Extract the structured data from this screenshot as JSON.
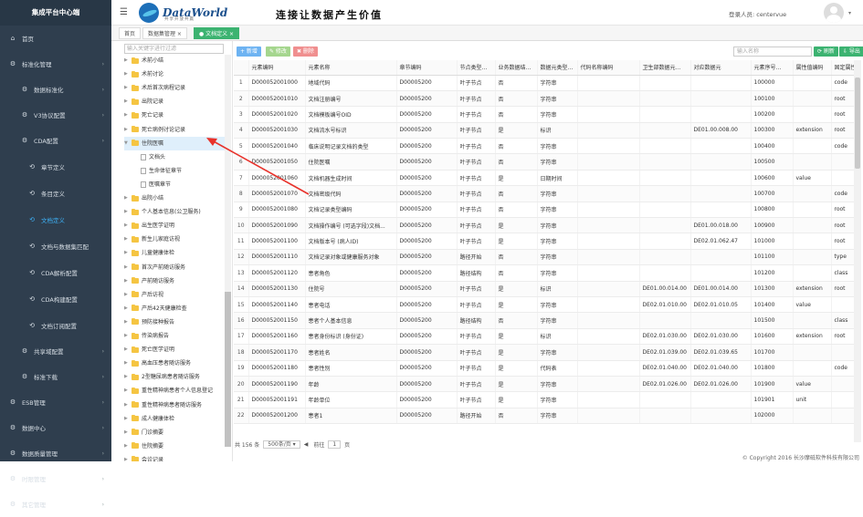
{
  "sidebar": {
    "brand": "集成平台中心端",
    "items": [
      {
        "label": "首页",
        "icon": "home-icon",
        "level": 0,
        "expand": false
      },
      {
        "label": "标准化管理",
        "icon": "gear-icon",
        "level": 0,
        "expand": true
      },
      {
        "label": "数据标准化",
        "icon": "gear-icon",
        "level": 1,
        "expand": true
      },
      {
        "label": "V3协议配置",
        "icon": "gear-icon",
        "level": 1,
        "expand": true
      },
      {
        "label": "CDA配置",
        "icon": "gear-icon",
        "level": 1,
        "expand": true
      },
      {
        "label": "章节定义",
        "icon": "share-icon",
        "level": 2,
        "active": false
      },
      {
        "label": "条目定义",
        "icon": "share-icon",
        "level": 2,
        "active": false
      },
      {
        "label": "文档定义",
        "icon": "share-icon",
        "level": 2,
        "active": true
      },
      {
        "label": "文档与数据集匹配",
        "icon": "share-icon",
        "level": 2,
        "active": false
      },
      {
        "label": "CDA解析配置",
        "icon": "share-icon",
        "level": 2,
        "active": false
      },
      {
        "label": "CDA构建配置",
        "icon": "share-icon",
        "level": 2,
        "active": false
      },
      {
        "label": "文档订阅配置",
        "icon": "share-icon",
        "level": 2,
        "active": false
      },
      {
        "label": "共享域配置",
        "icon": "gear-icon",
        "level": 1,
        "expand": true
      },
      {
        "label": "标准下载",
        "icon": "gear-icon",
        "level": 1,
        "expand": true
      },
      {
        "label": "ESB管理",
        "icon": "gear-icon",
        "level": 0,
        "expand": true
      },
      {
        "label": "数据中心",
        "icon": "gear-icon",
        "level": 0,
        "expand": true
      },
      {
        "label": "数据质量管理",
        "icon": "gear-icon",
        "level": 0,
        "expand": true
      },
      {
        "label": "时限管理",
        "icon": "gear-icon",
        "level": 0,
        "expand": true
      },
      {
        "label": "其它管理",
        "icon": "gear-icon",
        "level": 0,
        "expand": true
      }
    ]
  },
  "header": {
    "logo_text": "DataWorld",
    "logo_sub": "共享开放共赢",
    "slogan": "连接让数据产生价值",
    "login_label": "登录人员: centervue"
  },
  "tabs": [
    {
      "label": "首页",
      "active": false
    },
    {
      "label": "数据集管理 ×",
      "active": false
    },
    {
      "label": "● 文档定义 ×",
      "active": true
    }
  ],
  "tree": {
    "search_placeholder": "输入关键字进行过滤",
    "nodes": [
      {
        "label": "术前小结",
        "type": "folder",
        "level": 0
      },
      {
        "label": "术前讨论",
        "type": "folder",
        "level": 0
      },
      {
        "label": "术后首次病程记录",
        "type": "folder",
        "level": 0
      },
      {
        "label": "出院记录",
        "type": "folder",
        "level": 0
      },
      {
        "label": "死亡记录",
        "type": "folder",
        "level": 0
      },
      {
        "label": "死亡病例讨论记录",
        "type": "folder",
        "level": 0
      },
      {
        "label": "住院医嘱",
        "type": "folder",
        "level": 0,
        "open": true,
        "selected": true
      },
      {
        "label": "文档头",
        "type": "file",
        "level": 1
      },
      {
        "label": "生命体征章节",
        "type": "file",
        "level": 1
      },
      {
        "label": "医嘱章节",
        "type": "file",
        "level": 1
      },
      {
        "label": "出院小结",
        "type": "folder",
        "level": 0
      },
      {
        "label": "个人基本信息(公卫服务)",
        "type": "folder",
        "level": 0
      },
      {
        "label": "出生医学证明",
        "type": "folder",
        "level": 0
      },
      {
        "label": "新生儿家庭访视",
        "type": "folder",
        "level": 0
      },
      {
        "label": "儿童健康体检",
        "type": "folder",
        "level": 0
      },
      {
        "label": "首次产前随访服务",
        "type": "folder",
        "level": 0
      },
      {
        "label": "产前随访服务",
        "type": "folder",
        "level": 0
      },
      {
        "label": "产后访视",
        "type": "folder",
        "level": 0
      },
      {
        "label": "产后42天健康检查",
        "type": "folder",
        "level": 0
      },
      {
        "label": "预防接种报告",
        "type": "folder",
        "level": 0
      },
      {
        "label": "传染病报告",
        "type": "folder",
        "level": 0
      },
      {
        "label": "死亡医学证明",
        "type": "folder",
        "level": 0
      },
      {
        "label": "高血压患者随访服务",
        "type": "folder",
        "level": 0
      },
      {
        "label": "2型糖尿病患者随访服务",
        "type": "folder",
        "level": 0
      },
      {
        "label": "重性精神病患者个人信息登记",
        "type": "folder",
        "level": 0
      },
      {
        "label": "重性精神病患者随访服务",
        "type": "folder",
        "level": 0
      },
      {
        "label": "成人健康体检",
        "type": "folder",
        "level": 0
      },
      {
        "label": "门诊摘要",
        "type": "folder",
        "level": 0
      },
      {
        "label": "住院摘要",
        "type": "folder",
        "level": 0
      },
      {
        "label": "会诊记录",
        "type": "folder",
        "level": 0
      }
    ]
  },
  "toolbar": {
    "add_label": "+ 新增",
    "edit_label": "✎ 修改",
    "delete_label": "✖ 删除",
    "search_placeholder": "输入名称",
    "refresh_label": "⟳ 刷新",
    "export_label": "⇩ 导出"
  },
  "table": {
    "columns": [
      "",
      "元素编码",
      "元素名称",
      "章节编码",
      "节点类型...",
      "业务数据结...",
      "数据元类型...",
      "代码名称编码",
      "卫生部数据元...",
      "对应数据元",
      "元素序号...",
      "属性值编码",
      "固定属性"
    ],
    "rows": [
      [
        "1",
        "D000052001000",
        "地域代码",
        "D00005200",
        "叶子节点",
        "否",
        "字符串",
        "",
        "",
        "",
        "100000",
        "",
        "code"
      ],
      [
        "2",
        "D000052001010",
        "文档注册编号",
        "D00005200",
        "叶子节点",
        "否",
        "字符串",
        "",
        "",
        "",
        "100100",
        "",
        "root"
      ],
      [
        "3",
        "D000052001020",
        "文档模板编号OID",
        "D00005200",
        "叶子节点",
        "否",
        "字符串",
        "",
        "",
        "",
        "100200",
        "",
        "root"
      ],
      [
        "4",
        "D000052001030",
        "文档流水号标识",
        "D00005200",
        "叶子节点",
        "是",
        "标识",
        "",
        "",
        "DE01.00.008.00",
        "100300",
        "extension",
        "root"
      ],
      [
        "5",
        "D000052001040",
        "临床说明记录文档的类型",
        "D00005200",
        "叶子节点",
        "否",
        "字符串",
        "",
        "",
        "",
        "100400",
        "",
        "code"
      ],
      [
        "6",
        "D000052001050",
        "住院医嘱",
        "D00005200",
        "叶子节点",
        "否",
        "字符串",
        "",
        "",
        "",
        "100500",
        "",
        ""
      ],
      [
        "7",
        "D000052001060",
        "文档机器生成时间",
        "D00005200",
        "叶子节点",
        "是",
        "日期时间",
        "",
        "",
        "",
        "100600",
        "value",
        ""
      ],
      [
        "8",
        "D000052001070",
        "文档密级代码",
        "D00005200",
        "叶子节点",
        "否",
        "字符串",
        "",
        "",
        "",
        "100700",
        "",
        "code"
      ],
      [
        "9",
        "D000052001080",
        "文档记录类型编码",
        "D00005200",
        "叶子节点",
        "否",
        "字符串",
        "",
        "",
        "",
        "100800",
        "",
        "root"
      ],
      [
        "10",
        "D000052001090",
        "文档操作编号 (可选字段)文档...",
        "D00005200",
        "叶子节点",
        "是",
        "字符串",
        "",
        "",
        "DE01.00.018.00",
        "100900",
        "",
        "root"
      ],
      [
        "11",
        "D000052001100",
        "文档版本号 (病人ID)",
        "D00005200",
        "叶子节点",
        "是",
        "字符串",
        "",
        "",
        "DE02.01.062.47",
        "101000",
        "",
        "root"
      ],
      [
        "12",
        "D000052001110",
        "文档记录对象或健康服务对象",
        "D00005200",
        "路径开始",
        "否",
        "字符串",
        "",
        "",
        "",
        "101100",
        "",
        "type"
      ],
      [
        "13",
        "D000052001120",
        "患者角色",
        "D00005200",
        "路径结构",
        "否",
        "字符串",
        "",
        "",
        "",
        "101200",
        "",
        "class"
      ],
      [
        "14",
        "D000052001130",
        "住院号",
        "D00005200",
        "叶子节点",
        "是",
        "标识",
        "",
        "DE01.00.014.00",
        "DE01.00.014.00",
        "101300",
        "extension",
        "root"
      ],
      [
        "15",
        "D000052001140",
        "患者电话",
        "D00005200",
        "叶子节点",
        "是",
        "字符串",
        "",
        "DE02.01.010.00",
        "DE02.01.010.05",
        "101400",
        "value",
        ""
      ],
      [
        "16",
        "D000052001150",
        "患者个人基本信息",
        "D00005200",
        "路径结构",
        "否",
        "字符串",
        "",
        "",
        "",
        "101500",
        "",
        "class"
      ],
      [
        "17",
        "D000052001160",
        "患者身份标识 (身份证)",
        "D00005200",
        "叶子节点",
        "是",
        "标识",
        "",
        "DE02.01.030.00",
        "DE02.01.030.00",
        "101600",
        "extension",
        "root"
      ],
      [
        "18",
        "D000052001170",
        "患者姓名",
        "D00005200",
        "叶子节点",
        "是",
        "字符串",
        "",
        "DE02.01.039.00",
        "DE02.01.039.65",
        "101700",
        "",
        ""
      ],
      [
        "19",
        "D000052001180",
        "患者性别",
        "D00005200",
        "叶子节点",
        "是",
        "代码表",
        "",
        "DE02.01.040.00",
        "DE02.01.040.00",
        "101800",
        "",
        "code"
      ],
      [
        "20",
        "D000052001190",
        "年龄",
        "D00005200",
        "叶子节点",
        "是",
        "字符串",
        "",
        "DE02.01.026.00",
        "DE02.01.026.00",
        "101900",
        "value",
        ""
      ],
      [
        "21",
        "D000052001191",
        "年龄单位",
        "D00005200",
        "叶子节点",
        "是",
        "字符串",
        "",
        "",
        "",
        "101901",
        "unit",
        ""
      ],
      [
        "22",
        "D000052001200",
        "患者1",
        "D00005200",
        "路径开始",
        "否",
        "字符串",
        "",
        "",
        "",
        "102000",
        "",
        ""
      ]
    ]
  },
  "pager": {
    "total": "共 156 条",
    "page_size": "500条/页 ▾",
    "prev": "前往",
    "page": "1",
    "suffix": "页"
  },
  "footer": {
    "copyright": "© Copyright 2016 长沙摩砥软件科技有限公司"
  }
}
